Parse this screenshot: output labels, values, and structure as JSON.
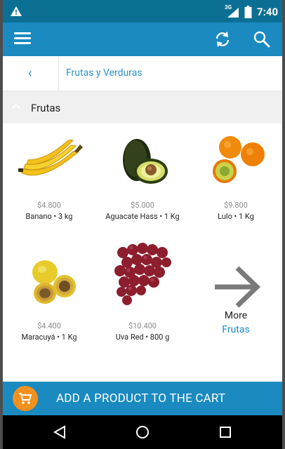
{
  "status_bar": {
    "network": "3G",
    "time": "7:40"
  },
  "app_bar": {
    "icons": [
      "menu-icon",
      "refresh-icon",
      "search-icon"
    ]
  },
  "breadcrumb": {
    "back": "‹",
    "title": "Frutas y Verduras"
  },
  "section": {
    "title": "Frutas"
  },
  "products": [
    {
      "price": "$4.800",
      "name": "Banano • 3 kg"
    },
    {
      "price": "$5.000",
      "name": "Aguacate Hass • 1 Kg"
    },
    {
      "price": "$9.800",
      "name": "Lulo • 1 Kg"
    },
    {
      "price": "$4.400",
      "name": "Maracuyá • 1 Kg"
    },
    {
      "price": "$10.400",
      "name": "Uva Red • 800 g"
    }
  ],
  "more": {
    "label": "More",
    "category": "Frutas"
  },
  "cart_bar": {
    "label": "ADD A PRODUCT TO THE CART"
  },
  "colors": {
    "status_bar": "#0b6f94",
    "app_bar": "#1a8ac0",
    "cart_circle": "#f4901e"
  }
}
